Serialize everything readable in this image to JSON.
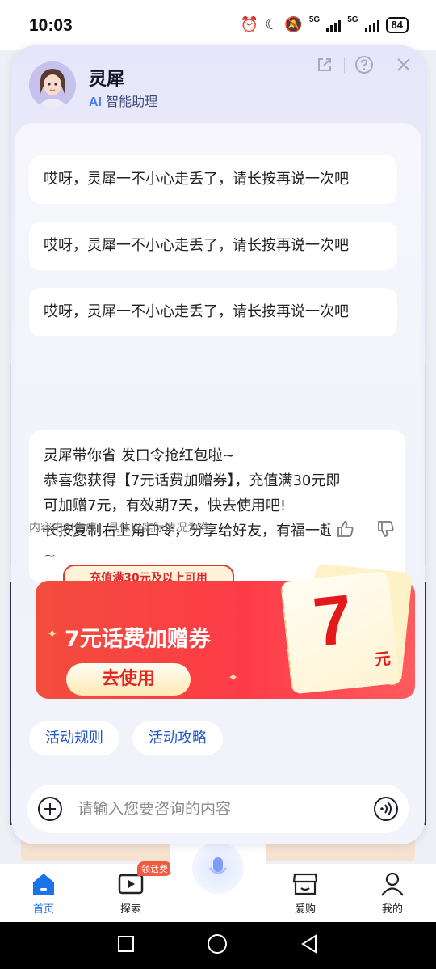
{
  "status": {
    "time": "10:03",
    "net1": "5G",
    "net2": "5G",
    "battery": "84"
  },
  "assistant": {
    "name": "灵犀",
    "subtitle_prefix": "AI",
    "subtitle": "智能助理"
  },
  "messages": [
    "哎呀，灵犀一不小心走丢了，请长按再说一次吧",
    "哎呀，灵犀一不小心走丢了，请长按再说一次吧",
    "哎呀，灵犀一不小心走丢了，请长按再说一次吧"
  ],
  "promo_message": {
    "line1": "灵犀带你省 发口令抢红包啦~",
    "line2": "恭喜您获得【7元话费加赠券】，充值满30元即",
    "line3": "可加赠7元，有效期7天，快去使用吧!",
    "line4": "长按复制右上角口令，分享给好友，有福一起享",
    "line5": "~"
  },
  "disclaimer": "内容由AI生成，具体以实际情况为准",
  "coupon": {
    "condition": "充值满30元及以上可用",
    "title": "7元话费加赠券",
    "button": "去使用",
    "amount": "7",
    "unit": "元"
  },
  "chips": [
    "活动规则",
    "活动攻略"
  ],
  "input": {
    "placeholder": "请输入您要咨询的内容"
  },
  "nav": {
    "home": "首页",
    "explore": "探索",
    "explore_badge": "领话费",
    "shop": "爱购",
    "mine": "我的"
  },
  "colors": {
    "accent": "#1a73e8",
    "coupon_red": "#f24c3c",
    "chip_text": "#2556c6"
  }
}
